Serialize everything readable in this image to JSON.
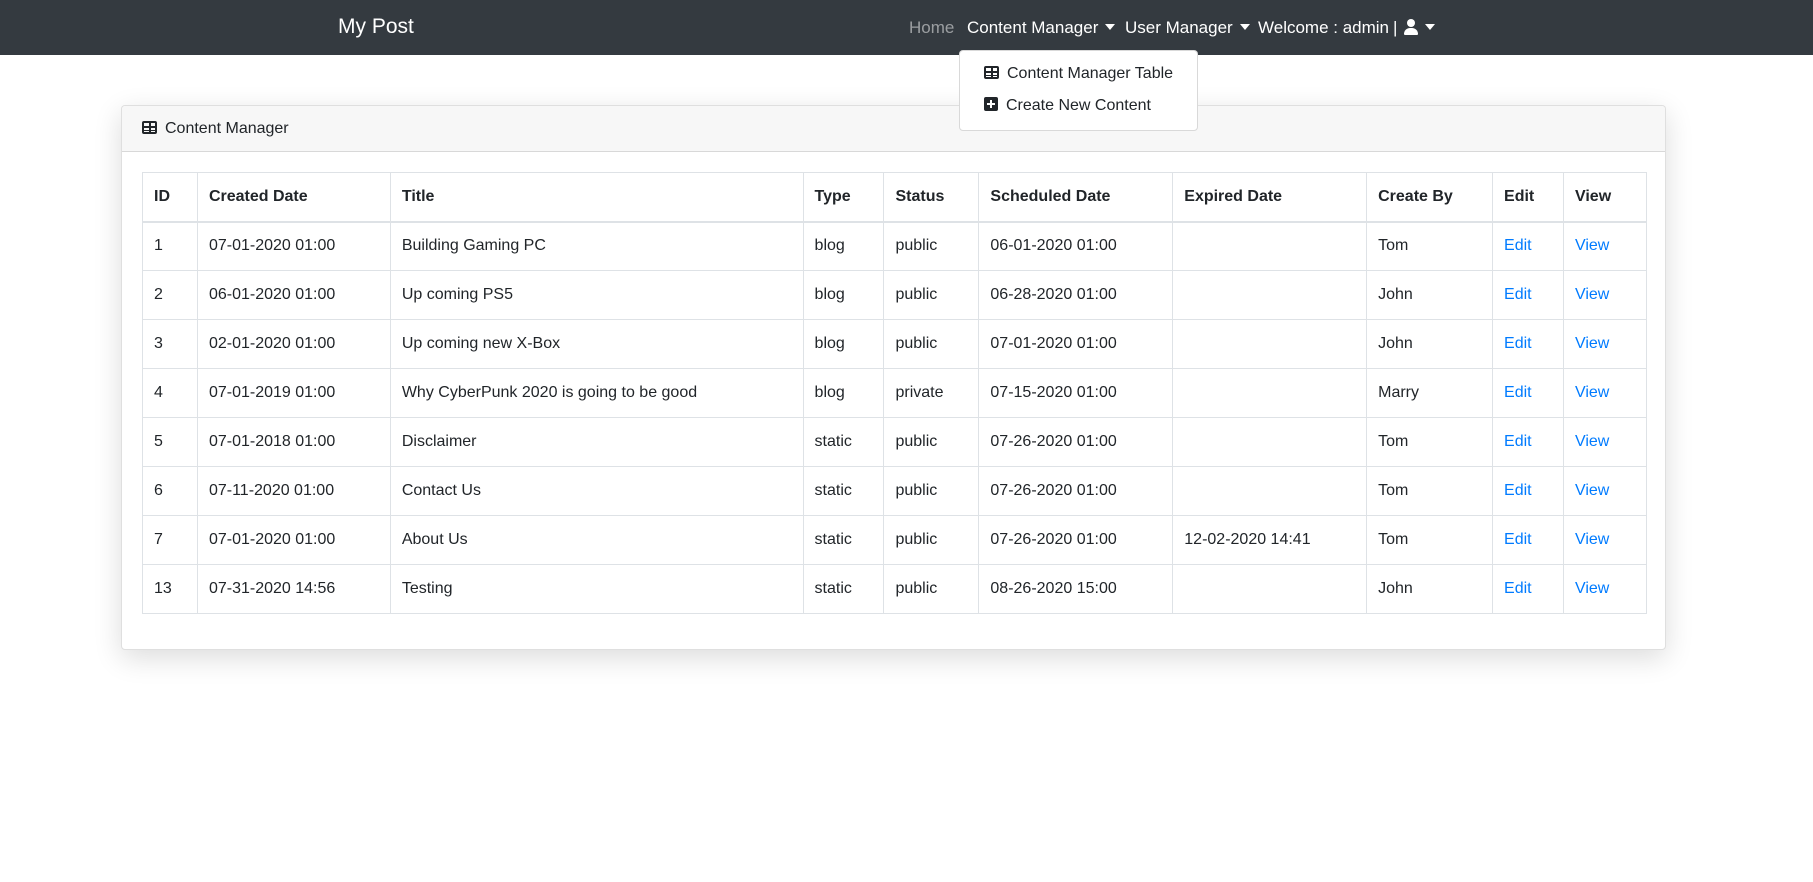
{
  "navbar": {
    "brand": "My Post",
    "home": "Home",
    "content_manager": "Content Manager",
    "user_manager": "User Manager",
    "welcome": "Welcome : admin",
    "separator": "|",
    "user_icon": "user-icon",
    "bg_color": "#343a40"
  },
  "dropdown": {
    "items": [
      {
        "label": "Content Manager Table",
        "icon": "table-icon"
      },
      {
        "label": "Create New Content",
        "icon": "plus-square-icon"
      }
    ]
  },
  "card": {
    "title": "Content Manager",
    "icon": "table-icon"
  },
  "table": {
    "columns": [
      "ID",
      "Created Date",
      "Title",
      "Type",
      "Status",
      "Scheduled Date",
      "Expired Date",
      "Create By",
      "Edit",
      "View"
    ],
    "rows": [
      {
        "id": "1",
        "created": "07-01-2020 01:00",
        "title": "Building Gaming PC",
        "type": "blog",
        "status": "public",
        "scheduled": "06-01-2020 01:00",
        "expired": "",
        "by": "Tom",
        "edit": "Edit",
        "view": "View"
      },
      {
        "id": "2",
        "created": "06-01-2020 01:00",
        "title": "Up coming PS5",
        "type": "blog",
        "status": "public",
        "scheduled": "06-28-2020 01:00",
        "expired": "",
        "by": "John",
        "edit": "Edit",
        "view": "View"
      },
      {
        "id": "3",
        "created": "02-01-2020 01:00",
        "title": "Up coming new X-Box",
        "type": "blog",
        "status": "public",
        "scheduled": "07-01-2020 01:00",
        "expired": "",
        "by": "John",
        "edit": "Edit",
        "view": "View"
      },
      {
        "id": "4",
        "created": "07-01-2019 01:00",
        "title": "Why CyberPunk 2020 is going to be good",
        "type": "blog",
        "status": "private",
        "scheduled": "07-15-2020 01:00",
        "expired": "",
        "by": "Marry",
        "edit": "Edit",
        "view": "View"
      },
      {
        "id": "5",
        "created": "07-01-2018 01:00",
        "title": "Disclaimer",
        "type": "static",
        "status": "public",
        "scheduled": "07-26-2020 01:00",
        "expired": "",
        "by": "Tom",
        "edit": "Edit",
        "view": "View"
      },
      {
        "id": "6",
        "created": "07-11-2020 01:00",
        "title": "Contact Us",
        "type": "static",
        "status": "public",
        "scheduled": "07-26-2020 01:00",
        "expired": "",
        "by": "Tom",
        "edit": "Edit",
        "view": "View"
      },
      {
        "id": "7",
        "created": "07-01-2020 01:00",
        "title": "About Us",
        "type": "static",
        "status": "public",
        "scheduled": "07-26-2020 01:00",
        "expired": "12-02-2020 14:41",
        "by": "Tom",
        "edit": "Edit",
        "view": "View"
      },
      {
        "id": "13",
        "created": "07-31-2020 14:56",
        "title": "Testing",
        "type": "static",
        "status": "public",
        "scheduled": "08-26-2020 15:00",
        "expired": "",
        "by": "John",
        "edit": "Edit",
        "view": "View"
      }
    ]
  },
  "colors": {
    "link": "#007bff",
    "muted_nav": "rgba(255,255,255,0.5)"
  }
}
